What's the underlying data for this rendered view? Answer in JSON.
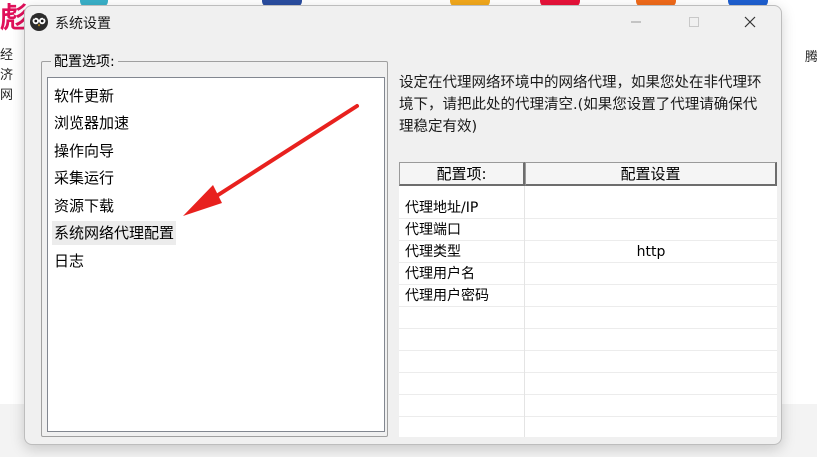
{
  "background": {
    "left_logo": "彪",
    "left_text": [
      "经济",
      "网"
    ],
    "right_text": "腾"
  },
  "window": {
    "title": "系统设置",
    "icon": "owl-app-icon",
    "controls": {
      "minimize": "minimize-icon",
      "maximize": "maximize-icon",
      "close": "close-icon"
    }
  },
  "options_group": {
    "label": "配置选项:",
    "items": [
      {
        "label": "软件更新"
      },
      {
        "label": "浏览器加速"
      },
      {
        "label": "操作向导"
      },
      {
        "label": "采集运行"
      },
      {
        "label": "资源下载"
      },
      {
        "label": "系统网络代理配置",
        "selected": true
      },
      {
        "label": "日志"
      }
    ]
  },
  "description": "设定在代理网络环境中的网络代理，如果您处在非代理环境下，请把此处的代理清空.(如果您设置了代理请确保代理稳定有效)",
  "table": {
    "headers": [
      "配置项:",
      "配置设置"
    ],
    "rows": [
      {
        "name": "代理地址/IP",
        "value": ""
      },
      {
        "name": "代理端口",
        "value": ""
      },
      {
        "name": "代理类型",
        "value": "http"
      },
      {
        "name": "代理用户名",
        "value": ""
      },
      {
        "name": "代理用户密码",
        "value": ""
      }
    ]
  },
  "colors": {
    "arrow": "#e8211e",
    "window_bg": "#f0f0f0",
    "selected_bg": "#ececec"
  }
}
